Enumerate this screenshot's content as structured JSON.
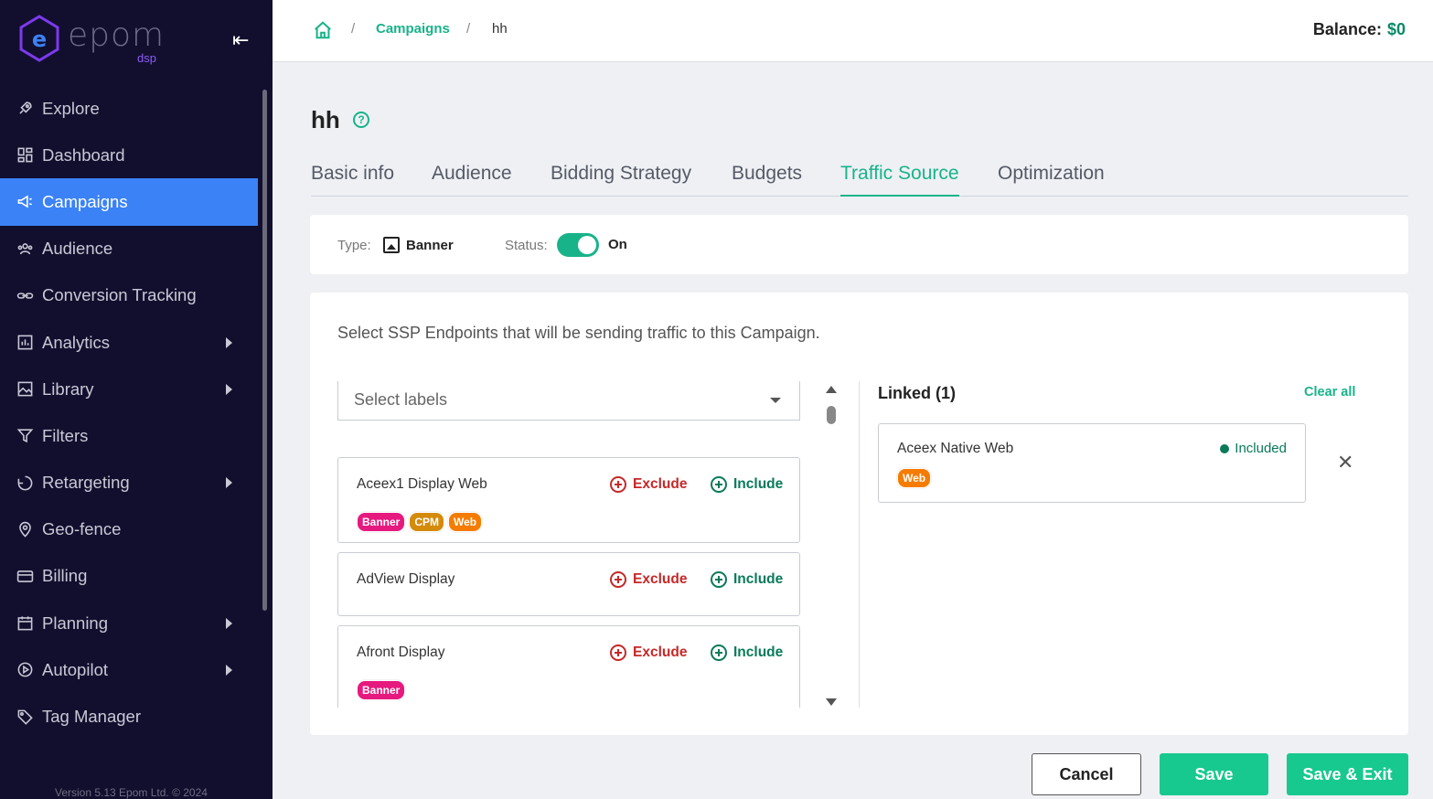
{
  "brand": {
    "name": "epom",
    "sub": "dsp"
  },
  "sidebar": {
    "items": [
      {
        "label": "Explore",
        "icon": "rocket-icon",
        "arrow": false,
        "active": false
      },
      {
        "label": "Dashboard",
        "icon": "dashboard-icon",
        "arrow": false,
        "active": false
      },
      {
        "label": "Campaigns",
        "icon": "megaphone-icon",
        "arrow": false,
        "active": true
      },
      {
        "label": "Audience",
        "icon": "users-icon",
        "arrow": false,
        "active": false
      },
      {
        "label": "Conversion Tracking",
        "icon": "link-icon",
        "arrow": false,
        "active": false
      },
      {
        "label": "Analytics",
        "icon": "chart-icon",
        "arrow": true,
        "active": false
      },
      {
        "label": "Library",
        "icon": "image-icon",
        "arrow": true,
        "active": false
      },
      {
        "label": "Filters",
        "icon": "filter-icon",
        "arrow": false,
        "active": false
      },
      {
        "label": "Retargeting",
        "icon": "retarget-icon",
        "arrow": true,
        "active": false
      },
      {
        "label": "Geo-fence",
        "icon": "pin-icon",
        "arrow": false,
        "active": false
      },
      {
        "label": "Billing",
        "icon": "card-icon",
        "arrow": false,
        "active": false
      },
      {
        "label": "Planning",
        "icon": "calendar-icon",
        "arrow": true,
        "active": false
      },
      {
        "label": "Autopilot",
        "icon": "play-icon",
        "arrow": true,
        "active": false
      },
      {
        "label": "Tag Manager",
        "icon": "tag-icon",
        "arrow": false,
        "active": false
      }
    ],
    "version": "Version 5.13 Epom Ltd. © 2024"
  },
  "header": {
    "breadcrumb": {
      "sep": "/",
      "campaigns": "Campaigns",
      "current": "hh"
    },
    "balance_label": "Balance:",
    "balance_value": "$0"
  },
  "page": {
    "title": "hh",
    "help": "?",
    "tabs": [
      "Basic info",
      "Audience",
      "Bidding Strategy",
      "Budgets",
      "Traffic Source",
      "Optimization"
    ],
    "active_tab": "Traffic Source"
  },
  "type_bar": {
    "type_label": "Type:",
    "type_value": "Banner",
    "status_label": "Status:",
    "status_value": "On"
  },
  "traffic": {
    "description": "Select SSP Endpoints that will be sending traffic to this Campaign.",
    "select_placeholder": "Select labels",
    "exclude_label": "Exclude",
    "include_label": "Include",
    "endpoints": [
      {
        "name": "Aceex1 Display Web",
        "tags": [
          "Banner",
          "CPM",
          "Web"
        ]
      },
      {
        "name": "AdView Display",
        "tags": []
      },
      {
        "name": "Afront Display",
        "tags": [
          "Banner"
        ]
      }
    ],
    "linked_title": "Linked (1)",
    "clear_all": "Clear all",
    "linked": [
      {
        "name": "Aceex Native Web",
        "status": "Included",
        "tags": [
          "Web"
        ]
      }
    ]
  },
  "footer": {
    "cancel": "Cancel",
    "save": "Save",
    "save_exit": "Save & Exit"
  },
  "colors": {
    "accent": "#19b38a",
    "sidebar_bg": "#120f2e",
    "active_nav": "#3b82f6",
    "exclude": "#c62828",
    "include": "#0a7a5a"
  }
}
